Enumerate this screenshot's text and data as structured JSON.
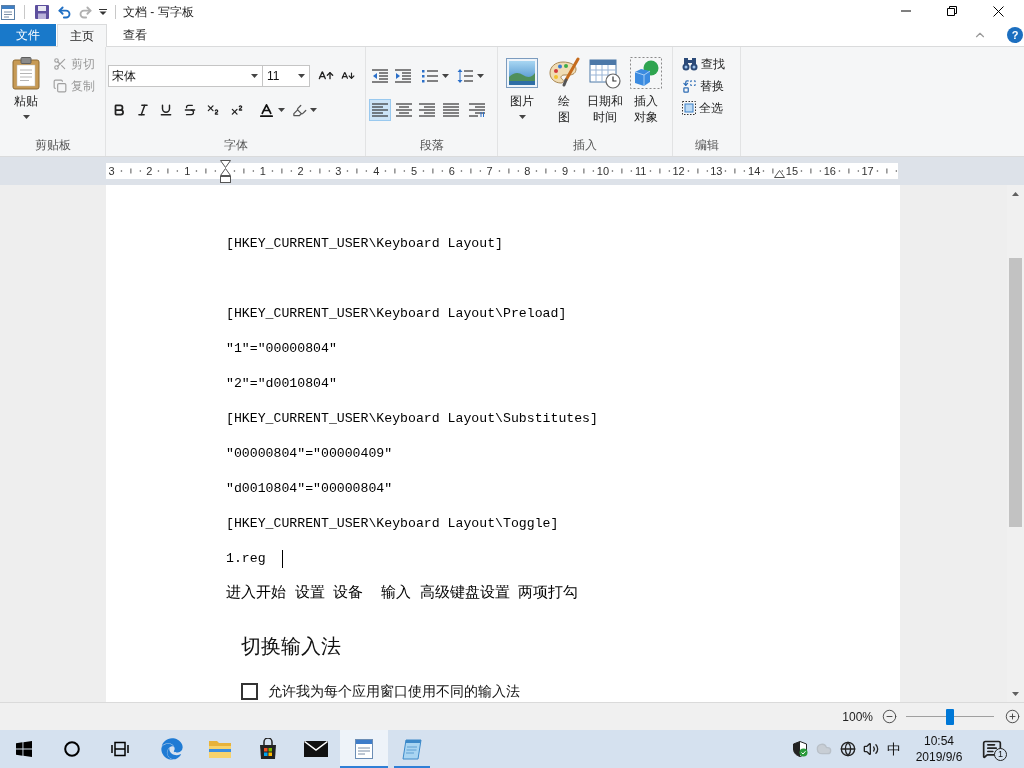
{
  "title_bar": {
    "title": "文档 - 写字板"
  },
  "ribbon_tabs": [
    {
      "label": "文件",
      "kind": "file",
      "selected": false
    },
    {
      "label": "主页",
      "kind": "tab",
      "selected": true
    },
    {
      "label": "查看",
      "kind": "tab",
      "selected": false
    }
  ],
  "help": "?",
  "ribbon": {
    "clipboard": {
      "label": "剪贴板",
      "paste": "粘贴",
      "commands": [
        {
          "label": "剪切",
          "kind": "cut",
          "disabled": true
        },
        {
          "label": "复制",
          "kind": "copy",
          "disabled": true
        }
      ]
    },
    "font": {
      "label": "字体",
      "font_name": "宋体",
      "font_size": "11"
    },
    "paragraph": {
      "label": "段落",
      "alignments": [
        {
          "kind": "left",
          "selected": true
        },
        {
          "kind": "center",
          "selected": false
        },
        {
          "kind": "right",
          "selected": false
        },
        {
          "kind": "justify",
          "selected": false
        }
      ]
    },
    "insert": {
      "label": "插入",
      "items": [
        {
          "label": "图片",
          "kind": "picture",
          "dropdown": true
        },
        {
          "label": "绘图",
          "kind": "paint",
          "dropdown": false
        },
        {
          "label": "日期和时间",
          "kind": "datetime",
          "dropdown": false
        },
        {
          "label": "插入对象",
          "kind": "object",
          "dropdown": false
        }
      ]
    },
    "editing": {
      "label": "编辑",
      "commands": [
        {
          "label": "查找",
          "kind": "find"
        },
        {
          "label": "替换",
          "kind": "replace"
        },
        {
          "label": "全选",
          "kind": "select_all"
        }
      ]
    }
  },
  "ruler": {
    "left_labels": [
      "3",
      "2",
      "1"
    ],
    "right_labels": [
      "1",
      "2",
      "3",
      "4",
      "5",
      "6",
      "7",
      "8",
      "9",
      "10",
      "11",
      "12",
      "13",
      "14",
      "15",
      "16",
      "17"
    ]
  },
  "document": {
    "lines": [
      {
        "kind": "code",
        "text": "[HKEY_CURRENT_USER\\Keyboard Layout]",
        "caret": false
      },
      {
        "kind": "blank"
      },
      {
        "kind": "code",
        "text": "[HKEY_CURRENT_USER\\Keyboard Layout\\Preload]",
        "caret": false
      },
      {
        "kind": "code",
        "text": "\"1\"=\"00000804\"",
        "caret": false
      },
      {
        "kind": "code",
        "text": "\"2\"=\"d0010804\"",
        "caret": false
      },
      {
        "kind": "code",
        "text": "[HKEY_CURRENT_USER\\Keyboard Layout\\Substitutes]",
        "caret": false
      },
      {
        "kind": "code",
        "text": "\"00000804\"=\"00000409\"",
        "caret": false
      },
      {
        "kind": "code",
        "text": "\"d0010804\"=\"00000804\"",
        "caret": false
      },
      {
        "kind": "code",
        "text": "[HKEY_CURRENT_USER\\Keyboard Layout\\Toggle]",
        "caret": false
      },
      {
        "kind": "code",
        "text": "1.reg",
        "caret": true
      },
      {
        "kind": "text",
        "text": "进入开始 设置 设备  输入 高级键盘设置 两项打勾",
        "caret": false
      }
    ],
    "screenshot": {
      "heading": "切换输入法",
      "checkbox": {
        "label": "允许我为每个应用窗口使用不同的输入法",
        "checked": false
      }
    }
  },
  "status_bar": {
    "zoom": "100%",
    "zoom_slider": {
      "level": 0.5
    }
  },
  "taskbar": {
    "apps": [
      {
        "kind": "browser",
        "running": false,
        "selected": false
      },
      {
        "kind": "folder",
        "running": false,
        "selected": false
      },
      {
        "kind": "store",
        "running": false,
        "selected": false
      },
      {
        "kind": "mail",
        "running": false,
        "selected": false
      },
      {
        "kind": "wordpad",
        "running": true,
        "selected": true
      },
      {
        "kind": "notepad",
        "running": true,
        "selected": false
      }
    ],
    "tray": {
      "ime": "中",
      "time": "10:54",
      "date": "2019/9/6",
      "notifications": "1"
    }
  }
}
